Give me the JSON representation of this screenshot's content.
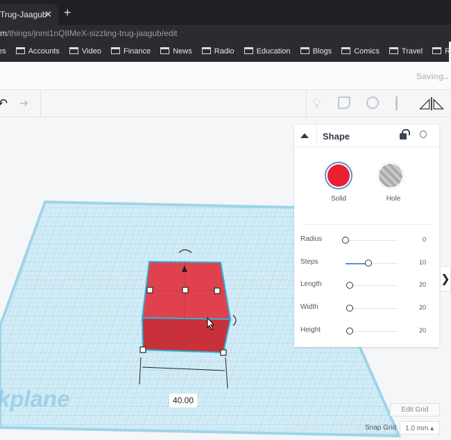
{
  "browser": {
    "tab_title": "Trug-Jaagub",
    "close": "✕",
    "new_tab": "+",
    "url_host": "m",
    "url_path": "/things/jnmi1nQ8MeX-sizzling-trug-jaagub/edit",
    "bookmarks": [
      "es",
      "Accounts",
      "Video",
      "Finance",
      "News",
      "Radio",
      "Education",
      "Blogs",
      "Comics",
      "Travel",
      "Researc"
    ]
  },
  "header": {
    "status": "Saving.."
  },
  "toolbar": {
    "undo": "↶",
    "redo": "➜",
    "icons": [
      "lightbulb-icon",
      "note-icon",
      "group-icon",
      "align-icon",
      "mirror-icon"
    ]
  },
  "panel": {
    "title": "Shape",
    "solid_label": "Solid",
    "hole_label": "Hole",
    "selected": "Solid",
    "solid_color": "#e8202f",
    "params": [
      {
        "label": "Radius",
        "value": "0",
        "fraction": 0
      },
      {
        "label": "Steps",
        "value": "10",
        "fraction": 0.45
      },
      {
        "label": "Length",
        "value": "20",
        "fraction": 0.07
      },
      {
        "label": "Width",
        "value": "20",
        "fraction": 0.07
      },
      {
        "label": "Height",
        "value": "20",
        "fraction": 0.07
      }
    ]
  },
  "viewport": {
    "dimension": "40.00",
    "watermark": "kplane",
    "edit_grid": "Edit Grid",
    "snap_label": "Snap Grid",
    "snap_value": "1.0 mm ▴"
  }
}
